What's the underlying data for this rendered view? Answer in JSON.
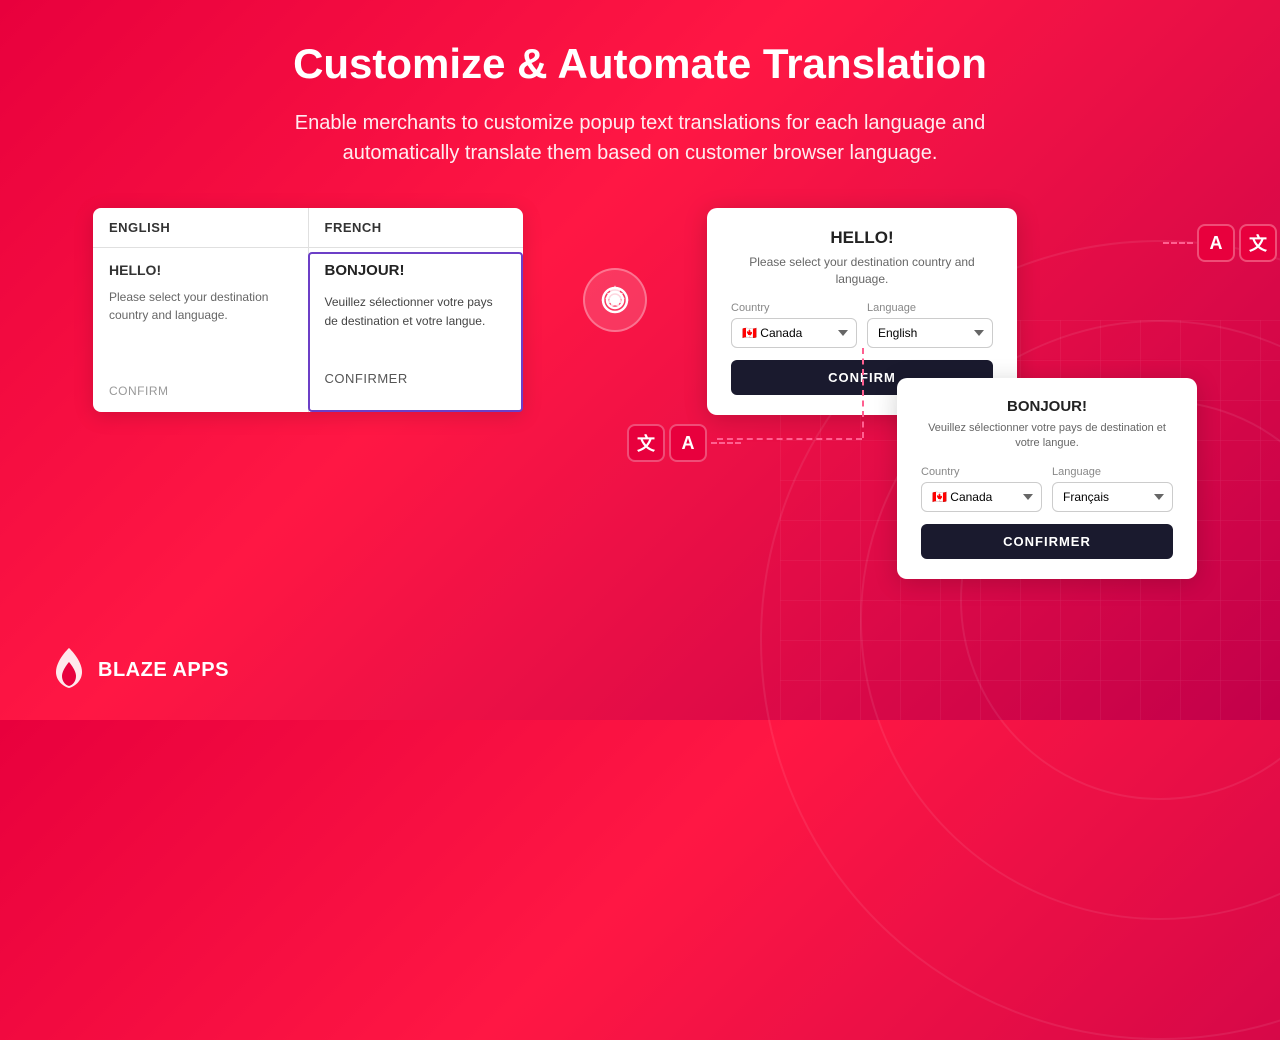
{
  "page": {
    "title": "Customize & Automate Translation",
    "subtitle": "Enable merchants to customize popup text translations for each language and automatically translate them based on customer browser language."
  },
  "translation_table": {
    "col1_header": "ENGLISH",
    "col2_header": "FRENCH",
    "english": {
      "title": "HELLO!",
      "body": "Please select your destination country and language.",
      "confirm": "CONFIRM"
    },
    "french": {
      "title": "BONJOUR!",
      "body": "Veuillez sélectionner votre pays de destination et votre langue.",
      "confirm": "CONFIRMER"
    }
  },
  "popup_english": {
    "title": "HELLO!",
    "subtitle": "Please select your destination country and language.",
    "country_label": "Country",
    "language_label": "Language",
    "country_value": "🇨🇦 Canada",
    "language_value": "English",
    "confirm_btn": "CONFIRM"
  },
  "popup_french": {
    "title": "BONJOUR!",
    "subtitle": "Veuillez sélectionner votre pays de destination et votre langue.",
    "country_label": "Country",
    "language_label": "Language",
    "country_value": "🇨🇦 Canada",
    "language_value": "Français",
    "confirm_btn": "CONFIRMER"
  },
  "logo": {
    "text": "BLAZE APPS"
  },
  "icons": {
    "translate_a": "A",
    "translate_zh": "文"
  }
}
